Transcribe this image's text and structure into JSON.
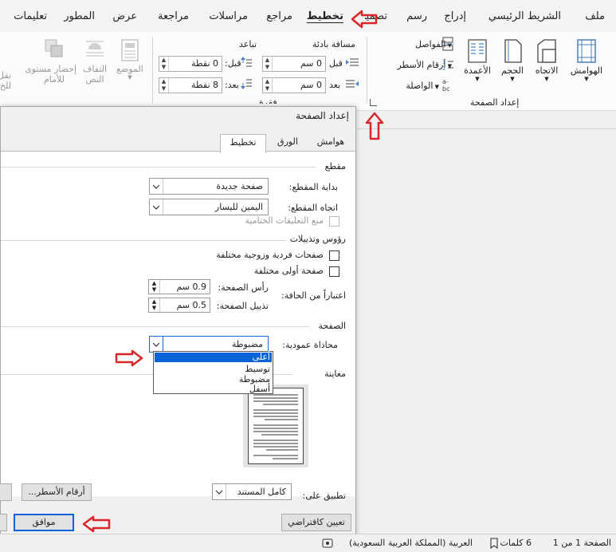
{
  "ribbon_tabs": [
    "ملف",
    "الشريط الرئيسي",
    "إدراج",
    "رسم",
    "تصميم",
    "تخطيط",
    "مراجع",
    "مراسلات",
    "مراجعة",
    "عرض",
    "المطور",
    "تعليمات"
  ],
  "ribbon": {
    "margins": "الهوامش",
    "orientation": "الاتجاه",
    "size": "الحجم",
    "columns": "الأعمدة",
    "breaks": "الفواصل",
    "line_numbers": "أرقام الأسطر",
    "hyphenation": "الواصلة",
    "page_setup_group": "إعداد الصفحة",
    "indent_header": "مسافة بادئة",
    "spacing_header": "تباعد",
    "indent_before_label": "قبل",
    "indent_before_value": "0 سم",
    "indent_after_label": "بعد",
    "indent_after_value": "0 سم",
    "spacing_before_label": "قبل:",
    "spacing_before_value": "0 نقطة",
    "spacing_after_label": "بعد:",
    "spacing_after_value": "8 نقطة",
    "paragraph_group": "فقرة",
    "position": "الموضع",
    "wrap_text_1": "التفاف",
    "wrap_text_2": "النص",
    "bring_forward_1": "إحضار مستوى",
    "bring_forward_2": "للأمام",
    "send_backward_1": "نقل",
    "send_backward_2": "للخ"
  },
  "dialog": {
    "title": "إعداد الصفحة",
    "tabs": [
      "هوامش",
      "الورق",
      "تخطيط"
    ],
    "section_label": "مقطع",
    "section_start_label": "بداية المقطع:",
    "section_start_value": "صفحة جديدة",
    "section_direction_label": "اتجاه المقطع:",
    "section_direction_value": "اليمين لليسار",
    "suppress_endnotes": "منع التعليقات الختامية",
    "headers_footers_label": "رؤوس وتذييلات",
    "odd_even": "صفحات فردية وزوجية مختلفة",
    "first_page": "صفحة أولى مختلفة",
    "from_edge": "اعتباراً من الحافة:",
    "header_label": "رأس الصفحة:",
    "header_value": "0.9 سم",
    "footer_label": "تذييل الصفحة:",
    "footer_value": "0.5 سم",
    "page_label": "الصفحة",
    "vertical_alignment_label": "محاذاة عمودية:",
    "vertical_alignment_value": "مضبوطة",
    "vertical_alignment_options": [
      "أعلى",
      "توسيط",
      "مضبوطة",
      "أسفل"
    ],
    "preview_label": "معاينة",
    "apply_to_label": "تطبيق على:",
    "apply_to_value": "كامل المستند",
    "line_numbers_button": "أرقام الأسطر...",
    "set_default_button": "تعيين كافتراضي",
    "ok_button": "موافق"
  },
  "status": {
    "page": "الصفحة 1 من 1",
    "words": "6 كلمات",
    "language": "العربية (المملكة العربية السعودية)"
  },
  "accent_color": "#0a64d8",
  "arrow_color": "#d9262a"
}
